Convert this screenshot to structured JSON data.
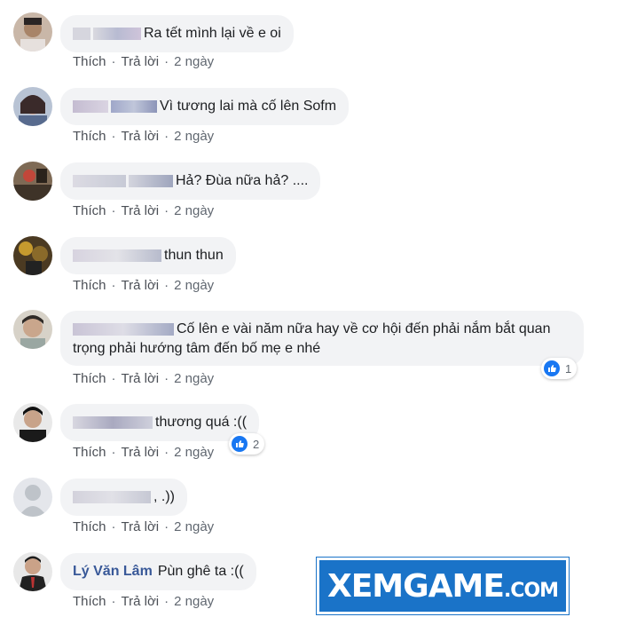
{
  "comments": [
    {
      "text": "Ra tết mình lại về e oi",
      "like": "Thích",
      "reply": "Trả lời",
      "time": "2 ngày"
    },
    {
      "text": "Vì tương lai mà cố lên Sofm",
      "like": "Thích",
      "reply": "Trả lời",
      "time": "2 ngày"
    },
    {
      "text": "Hả? Đùa nữa hả? ....",
      "like": "Thích",
      "reply": "Trả lời",
      "time": "2 ngày"
    },
    {
      "text": "thun thun",
      "like": "Thích",
      "reply": "Trả lời",
      "time": "2 ngày"
    },
    {
      "text": "Cố lên e vài năm nữa hay về cơ hội đến phải nắm bắt quan trọng phải hướng tâm đến bố mẹ e nhé",
      "like": "Thích",
      "reply": "Trả lời",
      "time": "2 ngày",
      "reactions": "1"
    },
    {
      "text": "thương quá :((",
      "like": "Thích",
      "reply": "Trả lời",
      "time": "2 ngày",
      "reactions": "2"
    },
    {
      "text": ", .))",
      "like": "Thích",
      "reply": "Trả lời",
      "time": "2 ngày"
    },
    {
      "name": "Lý Văn Lâm",
      "text": "Pùn ghê ta :((",
      "like": "Thích",
      "reply": "Trả lời",
      "time": "2 ngày"
    }
  ],
  "watermark": {
    "main": "XEMGAME",
    "suffix": ".COM"
  },
  "colors": {
    "bubble": "#f2f3f5",
    "name": "#385898",
    "like": "#1877f2",
    "watermark": "#1a73c8"
  }
}
